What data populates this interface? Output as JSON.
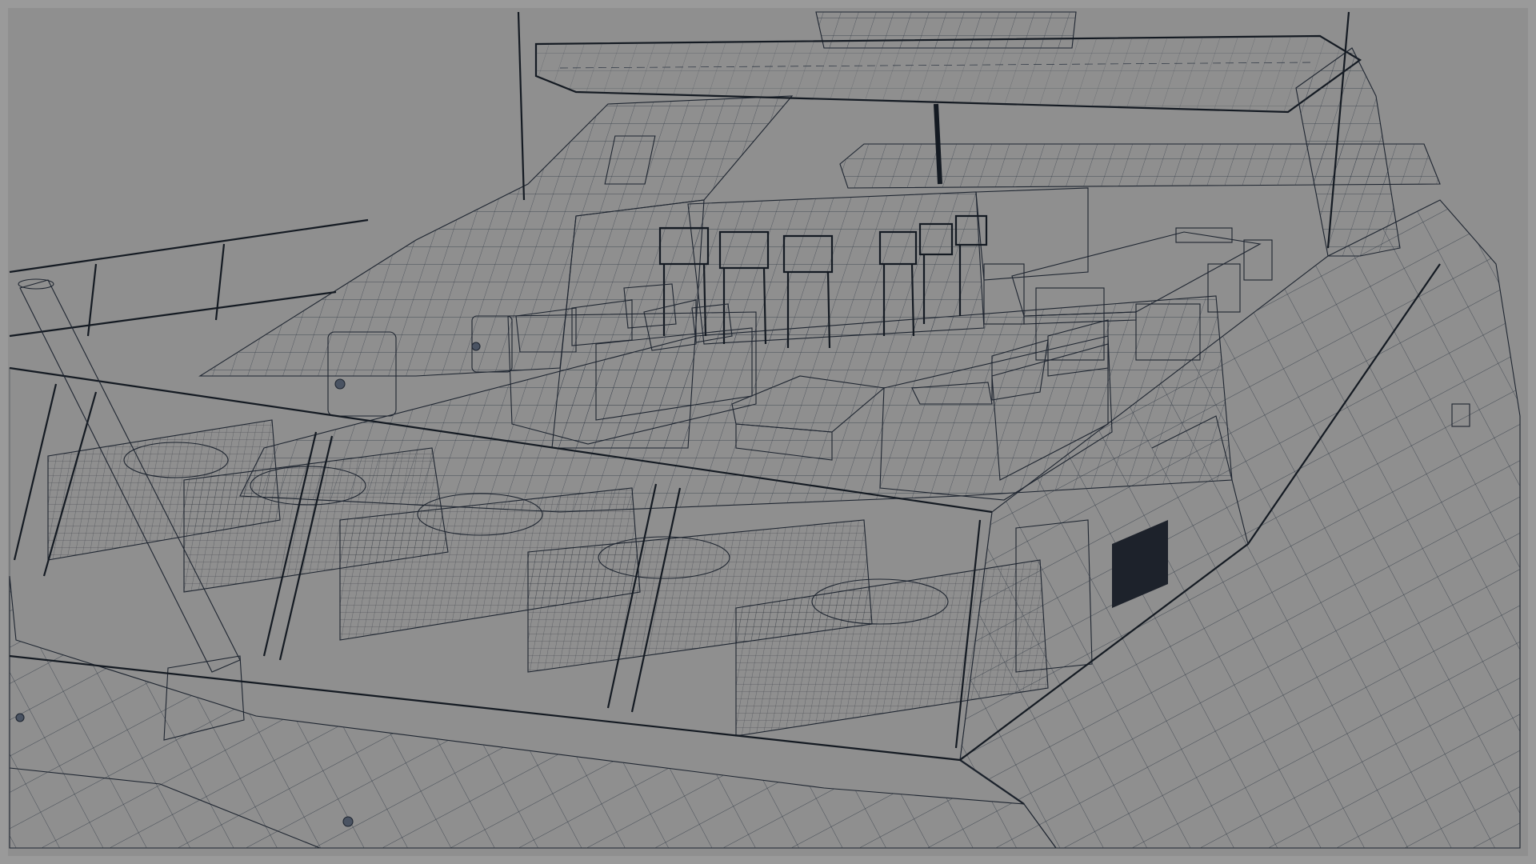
{
  "viewport": {
    "background_color": "#8f8f8f",
    "surface_color": "#aab6c6",
    "surface_shadow_color": "#7d8899",
    "surface_light_color": "#c3d0df",
    "wire_color": "#1e2530",
    "glass_color": "#9aa8b8"
  },
  "scene": {
    "subject": "yacht-flybridge-wireframe",
    "objects": [
      "hardtop-roof",
      "radar-arch",
      "mast-left",
      "mast-right",
      "mast-center",
      "bar-counter",
      "bar-stools",
      "dining-table",
      "dining-chairs",
      "lounge-sofa-left",
      "lounge-sofa-right",
      "coffee-table",
      "sun-pads",
      "pillows",
      "glass-bulwark",
      "glass-supports",
      "davit-post",
      "hull-side",
      "windshield"
    ]
  }
}
